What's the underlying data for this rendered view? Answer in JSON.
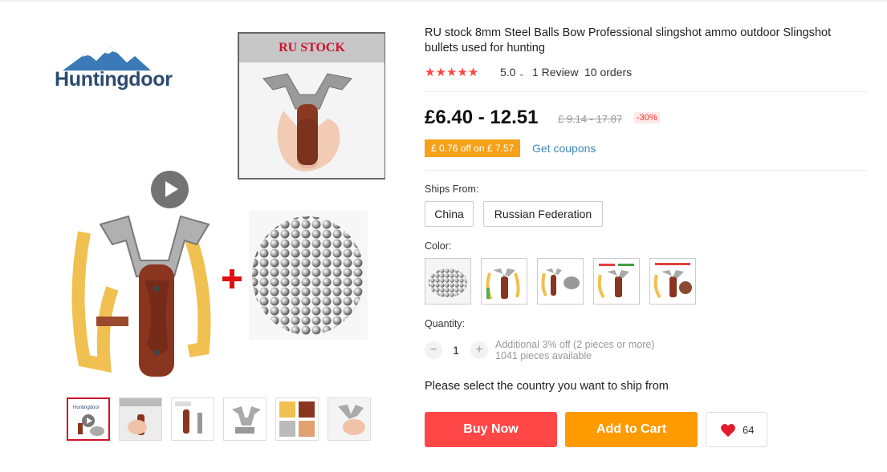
{
  "brand": {
    "logo_text": "Huntingdoor"
  },
  "gallery": {
    "ru_banner": "RU STOCK",
    "thumbnails": [
      "thumb-1",
      "thumb-2",
      "thumb-3",
      "thumb-4",
      "thumb-5",
      "thumb-6"
    ],
    "active_index": 0
  },
  "product": {
    "title": "RU stock 8mm Steel Balls Bow Professional slingshot ammo outdoor Slingshot bullets used for hunting",
    "rating": {
      "stars": 5,
      "value": "5.0",
      "reviews": "1 Review",
      "orders": "10 orders"
    },
    "price": "£6.40 - 12.51",
    "original_price": "£ 9.14 - 17.87",
    "discount": "-30%",
    "coupon": {
      "text": "£ 0.76 off on £ 7.57",
      "link": "Get coupons"
    }
  },
  "ships_from": {
    "label": "Ships From:",
    "options": [
      "China",
      "Russian Federation"
    ]
  },
  "color": {
    "label": "Color:",
    "options": [
      "steel-balls",
      "slingshot-with-bands",
      "slingshot-with-balls",
      "slingshot-kit",
      "slingshot-with-ammo"
    ]
  },
  "quantity": {
    "label": "Quantity:",
    "value": "1",
    "minus": "−",
    "plus": "+",
    "note_line1": "Additional 3% off (2 pieces or more)",
    "note_line2": "1041 pieces available"
  },
  "ship_message": "Please select the country you want to ship from",
  "actions": {
    "buy_now": "Buy Now",
    "add_to_cart": "Add to Cart",
    "wishlist_count": "64"
  },
  "colors": {
    "buy": "#ff4747",
    "cart": "#ff9a00",
    "star": "#ff4444",
    "coupon": "#f5a21a",
    "link": "#3d8ab8"
  }
}
